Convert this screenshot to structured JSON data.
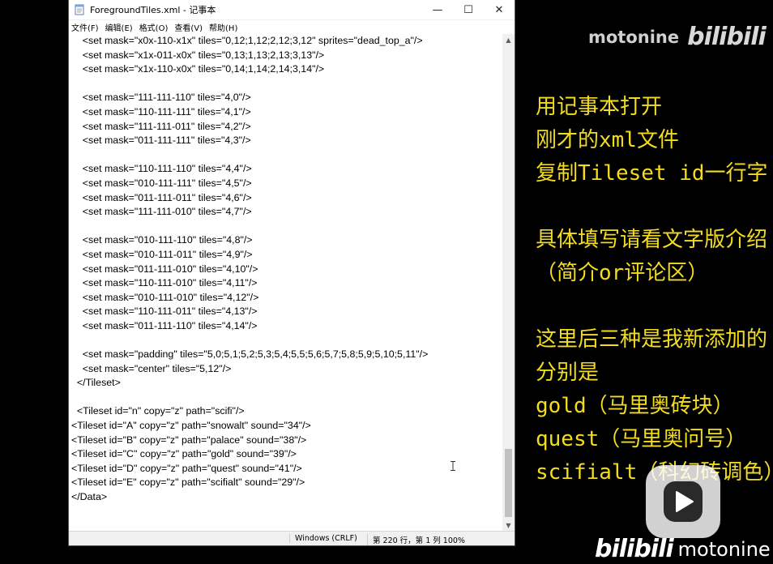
{
  "window": {
    "title": "ForegroundTiles.xml - 记事本",
    "minimize": "—",
    "maximize": "☐",
    "close": "✕"
  },
  "menu": [
    "文件(F)",
    "编辑(E)",
    "格式(O)",
    "查看(V)",
    "帮助(H)"
  ],
  "lines": [
    "    <set mask=\"x0x-110-x1x\" tiles=\"0,12;1,12;2,12;3,12\" sprites=\"dead_top_a\"/>",
    "    <set mask=\"x1x-011-x0x\" tiles=\"0,13;1,13;2,13;3,13\"/>",
    "    <set mask=\"x1x-110-x0x\" tiles=\"0,14;1,14;2,14;3,14\"/>",
    "",
    "    <set mask=\"111-111-110\" tiles=\"4,0\"/>",
    "    <set mask=\"110-111-111\" tiles=\"4,1\"/>",
    "    <set mask=\"111-111-011\" tiles=\"4,2\"/>",
    "    <set mask=\"011-111-111\" tiles=\"4,3\"/>",
    "",
    "    <set mask=\"110-111-110\" tiles=\"4,4\"/>",
    "    <set mask=\"010-111-111\" tiles=\"4,5\"/>",
    "    <set mask=\"011-111-011\" tiles=\"4,6\"/>",
    "    <set mask=\"111-111-010\" tiles=\"4,7\"/>",
    "",
    "    <set mask=\"010-111-110\" tiles=\"4,8\"/>",
    "    <set mask=\"010-111-011\" tiles=\"4,9\"/>",
    "    <set mask=\"011-111-010\" tiles=\"4,10\"/>",
    "    <set mask=\"110-111-010\" tiles=\"4,11\"/>",
    "    <set mask=\"010-111-010\" tiles=\"4,12\"/>",
    "    <set mask=\"110-111-011\" tiles=\"4,13\"/>",
    "    <set mask=\"011-111-110\" tiles=\"4,14\"/>",
    "",
    "    <set mask=\"padding\" tiles=\"5,0;5,1;5,2;5,3;5,4;5,5;5,6;5,7;5,8;5,9;5,10;5,11\"/>",
    "    <set mask=\"center\" tiles=\"5,12\"/>",
    "  </Tileset>",
    "",
    "  <Tileset id=\"n\" copy=\"z\" path=\"scifi\"/>",
    "<Tileset id=\"A\" copy=\"z\" path=\"snowalt\" sound=\"34\"/>",
    "<Tileset id=\"B\" copy=\"z\" path=\"palace\" sound=\"38\"/>",
    "<Tileset id=\"C\" copy=\"z\" path=\"gold\" sound=\"39\"/>",
    "<Tileset id=\"D\" copy=\"z\" path=\"quest\" sound=\"41\"/>",
    "<Tileset id=\"E\" copy=\"z\" path=\"scifialt\" sound=\"29\"/>",
    "</Data>"
  ],
  "status": {
    "encoding": "Windows (CRLF)",
    "position": "第 220 行，第 1 列 100%"
  },
  "watermark": {
    "channel": "motonine",
    "logo": "bilibili"
  },
  "notes": [
    "用记事本打开",
    "刚才的xml文件",
    "复制Tileset id一行字",
    "",
    "具体填写请看文字版介绍",
    "（简介or评论区）",
    "",
    "这里后三种是我新添加的",
    "分别是",
    "gold（马里奥砖块）",
    "quest（马里奥问号）",
    "scifialt（科幻砖调色）"
  ],
  "colors": {
    "notes_text": "#f3dc1f",
    "background": "#000000"
  }
}
